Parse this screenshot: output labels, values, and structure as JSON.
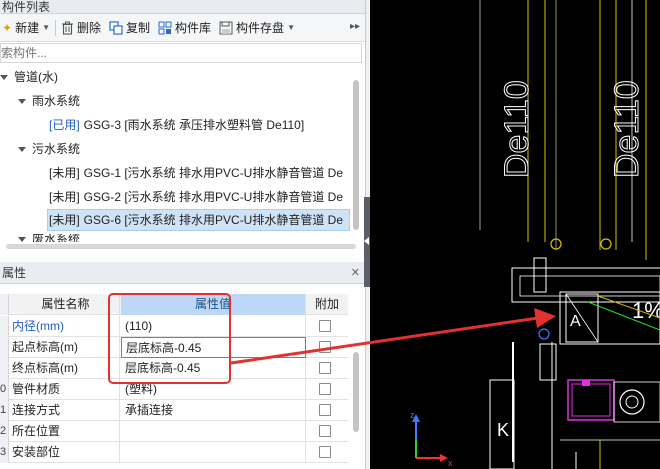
{
  "component_list": {
    "title": "构件列表",
    "toolbar": {
      "new": "新建",
      "delete": "删除",
      "copy": "复制",
      "library": "构件库",
      "save": "构件存盘"
    },
    "search_placeholder": "索构件...",
    "tree": {
      "root": "管道(水)",
      "rain": "雨水系统",
      "rain_item": {
        "tag": "[已用]",
        "text": "GSG-3 [雨水系统 承压排水塑料管 De110]"
      },
      "sewage": "污水系统",
      "items": [
        {
          "tag": "[未用]",
          "text": "GSG-1 [污水系统 排水用PVC-U排水静音管道 De"
        },
        {
          "tag": "[未用]",
          "text": "GSG-2 [污水系统 排水用PVC-U排水静音管道 De"
        },
        {
          "tag": "[未用]",
          "text": "GSG-6 [污水系统 排水用PVC-U排水静音管道 De"
        }
      ],
      "partial": "废水系统"
    }
  },
  "properties": {
    "title": "属性",
    "columns": {
      "name": "属性名称",
      "value": "属性值",
      "add": "附加"
    },
    "rows": [
      {
        "num": "",
        "name": "内径(mm)",
        "value": "(110)"
      },
      {
        "num": "",
        "name": "起点标高(m)",
        "value": "层底标高-0.45"
      },
      {
        "num": "",
        "name": "终点标高(m)",
        "value": "层底标高-0.45"
      },
      {
        "num": "0",
        "name": "管件材质",
        "value": "(塑料)"
      },
      {
        "num": "1",
        "name": "连接方式",
        "value": "承插连接"
      },
      {
        "num": "2",
        "name": "所在位置",
        "value": ""
      },
      {
        "num": "3",
        "name": "安装部位",
        "value": ""
      },
      {
        "num": "",
        "name": "",
        "value": ""
      }
    ]
  },
  "cad": {
    "label_left": "De110",
    "label_right": "De110",
    "slope_label": "1%",
    "letter_a": "A",
    "letter_k": "K"
  }
}
